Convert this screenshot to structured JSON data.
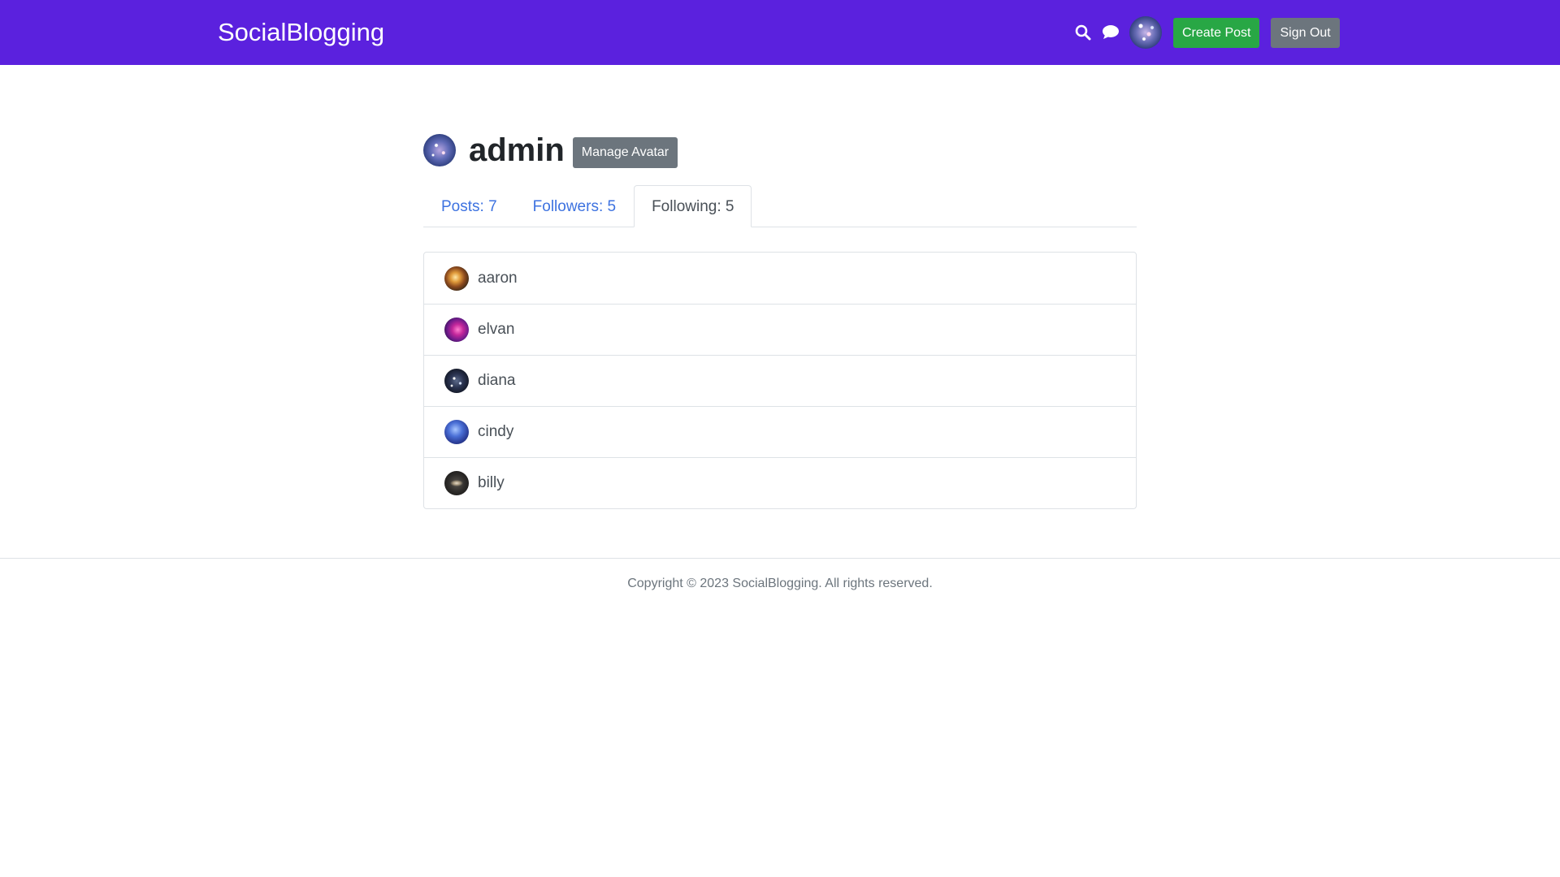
{
  "header": {
    "brand": "SocialBlogging",
    "search_icon": "search-icon",
    "chat_icon": "chat-icon",
    "create_post_label": "Create Post",
    "sign_out_label": "Sign Out"
  },
  "profile": {
    "username": "admin",
    "manage_avatar_label": "Manage Avatar"
  },
  "tabs": [
    {
      "label": "Posts: 7",
      "active": false
    },
    {
      "label": "Followers: 5",
      "active": false
    },
    {
      "label": "Following: 5",
      "active": true
    }
  ],
  "following": [
    {
      "username": "aaron"
    },
    {
      "username": "elvan"
    },
    {
      "username": "diana"
    },
    {
      "username": "cindy"
    },
    {
      "username": "billy"
    }
  ],
  "footer": {
    "copyright": "Copyright © 2023 SocialBlogging. All rights reserved."
  },
  "colors": {
    "header_bg": "#5b21de",
    "create_button": "#28a745",
    "secondary_button": "#6c757d",
    "tab_link": "#3d72e0"
  }
}
